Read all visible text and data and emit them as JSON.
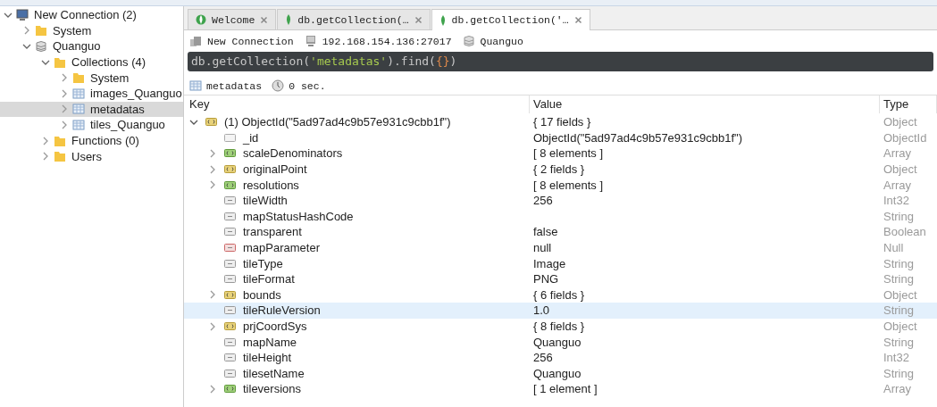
{
  "sidebar": {
    "tree": [
      {
        "label": "New Connection (2)",
        "kind": "server",
        "expanded": true,
        "selected": false,
        "children": [
          {
            "label": "System",
            "kind": "folder",
            "expanded": false,
            "selected": false
          },
          {
            "label": "Quanguo",
            "kind": "database",
            "expanded": true,
            "selected": false,
            "children": [
              {
                "label": "Collections (4)",
                "kind": "folder",
                "expanded": true,
                "selected": false,
                "children": [
                  {
                    "label": "System",
                    "kind": "folder",
                    "expanded": false,
                    "selected": false
                  },
                  {
                    "label": "images_Quanguo",
                    "kind": "collection",
                    "expanded": false,
                    "selected": false
                  },
                  {
                    "label": "metadatas",
                    "kind": "collection",
                    "expanded": false,
                    "selected": true
                  },
                  {
                    "label": "tiles_Quanguo",
                    "kind": "collection",
                    "expanded": false,
                    "selected": false
                  }
                ]
              },
              {
                "label": "Functions (0)",
                "kind": "folder",
                "expanded": false,
                "selected": false
              },
              {
                "label": "Users",
                "kind": "folder",
                "expanded": false,
                "selected": false
              }
            ]
          }
        ]
      }
    ]
  },
  "tabs": [
    {
      "label": "Welcome",
      "kind": "welcome",
      "selected": false
    },
    {
      "label": "db.getCollection(…",
      "kind": "query",
      "selected": false
    },
    {
      "label": "db.getCollection('…",
      "kind": "query",
      "selected": true
    }
  ],
  "connection_bar": {
    "connection": "New Connection",
    "server": "192.168.154.136:27017",
    "database": "Quanguo"
  },
  "query": [
    {
      "text": "db.getCollection(",
      "kind": "plain"
    },
    {
      "text": "'metadatas'",
      "kind": "string"
    },
    {
      "text": ").find(",
      "kind": "plain"
    },
    {
      "text": "{}",
      "kind": "brace"
    },
    {
      "text": ")",
      "kind": "plain"
    }
  ],
  "result_bar": {
    "collection": "metadatas",
    "time": "0 sec."
  },
  "table": {
    "columns": [
      "Key",
      "Value",
      "Type"
    ],
    "rows": [
      {
        "key": "(1) ObjectId(\"5ad97ad4c9b57e931c9cbb1f\")",
        "value": "{ 17 fields }",
        "type": "Object",
        "kind": "object",
        "expanded": true,
        "selected": false,
        "children": [
          {
            "key": "_id",
            "value": "ObjectId(\"5ad97ad4c9b57e931c9cbb1f\")",
            "type": "ObjectId",
            "kind": "objectid",
            "selected": false
          },
          {
            "key": "scaleDenominators",
            "value": "[ 8 elements ]",
            "type": "Array",
            "kind": "array",
            "expanded": false,
            "selected": false
          },
          {
            "key": "originalPoint",
            "value": "{ 2 fields }",
            "type": "Object",
            "kind": "object",
            "expanded": false,
            "selected": false
          },
          {
            "key": "resolutions",
            "value": "[ 8 elements ]",
            "type": "Array",
            "kind": "array",
            "expanded": false,
            "selected": false
          },
          {
            "key": "tileWidth",
            "value": "256",
            "type": "Int32",
            "kind": "int",
            "selected": false
          },
          {
            "key": "mapStatusHashCode",
            "type": "String",
            "kind": "string",
            "selected": false
          },
          {
            "key": "transparent",
            "value": "false",
            "type": "Boolean",
            "kind": "boolean",
            "selected": false
          },
          {
            "key": "mapParameter",
            "value": "null",
            "type": "Null",
            "kind": "null",
            "selected": false
          },
          {
            "key": "tileType",
            "value": "Image",
            "type": "String",
            "kind": "string",
            "selected": false
          },
          {
            "key": "tileFormat",
            "value": "PNG",
            "type": "String",
            "kind": "string",
            "selected": false
          },
          {
            "key": "bounds",
            "value": "{ 6 fields }",
            "type": "Object",
            "kind": "object",
            "expanded": false,
            "selected": false
          },
          {
            "key": "tileRuleVersion",
            "value": "1.0",
            "type": "String",
            "kind": "string",
            "selected": true
          },
          {
            "key": "prjCoordSys",
            "value": "{ 8 fields }",
            "type": "Object",
            "kind": "object",
            "expanded": false,
            "selected": false
          },
          {
            "key": "mapName",
            "value": "Quanguo",
            "type": "String",
            "kind": "string",
            "selected": false
          },
          {
            "key": "tileHeight",
            "value": "256",
            "type": "Int32",
            "kind": "int",
            "selected": false
          },
          {
            "key": "tilesetName",
            "value": "Quanguo",
            "type": "String",
            "kind": "string",
            "selected": false
          },
          {
            "key": "tileversions",
            "value": "[ 1 element ]",
            "type": "Array",
            "kind": "array",
            "expanded": false,
            "selected": false
          }
        ]
      }
    ]
  }
}
